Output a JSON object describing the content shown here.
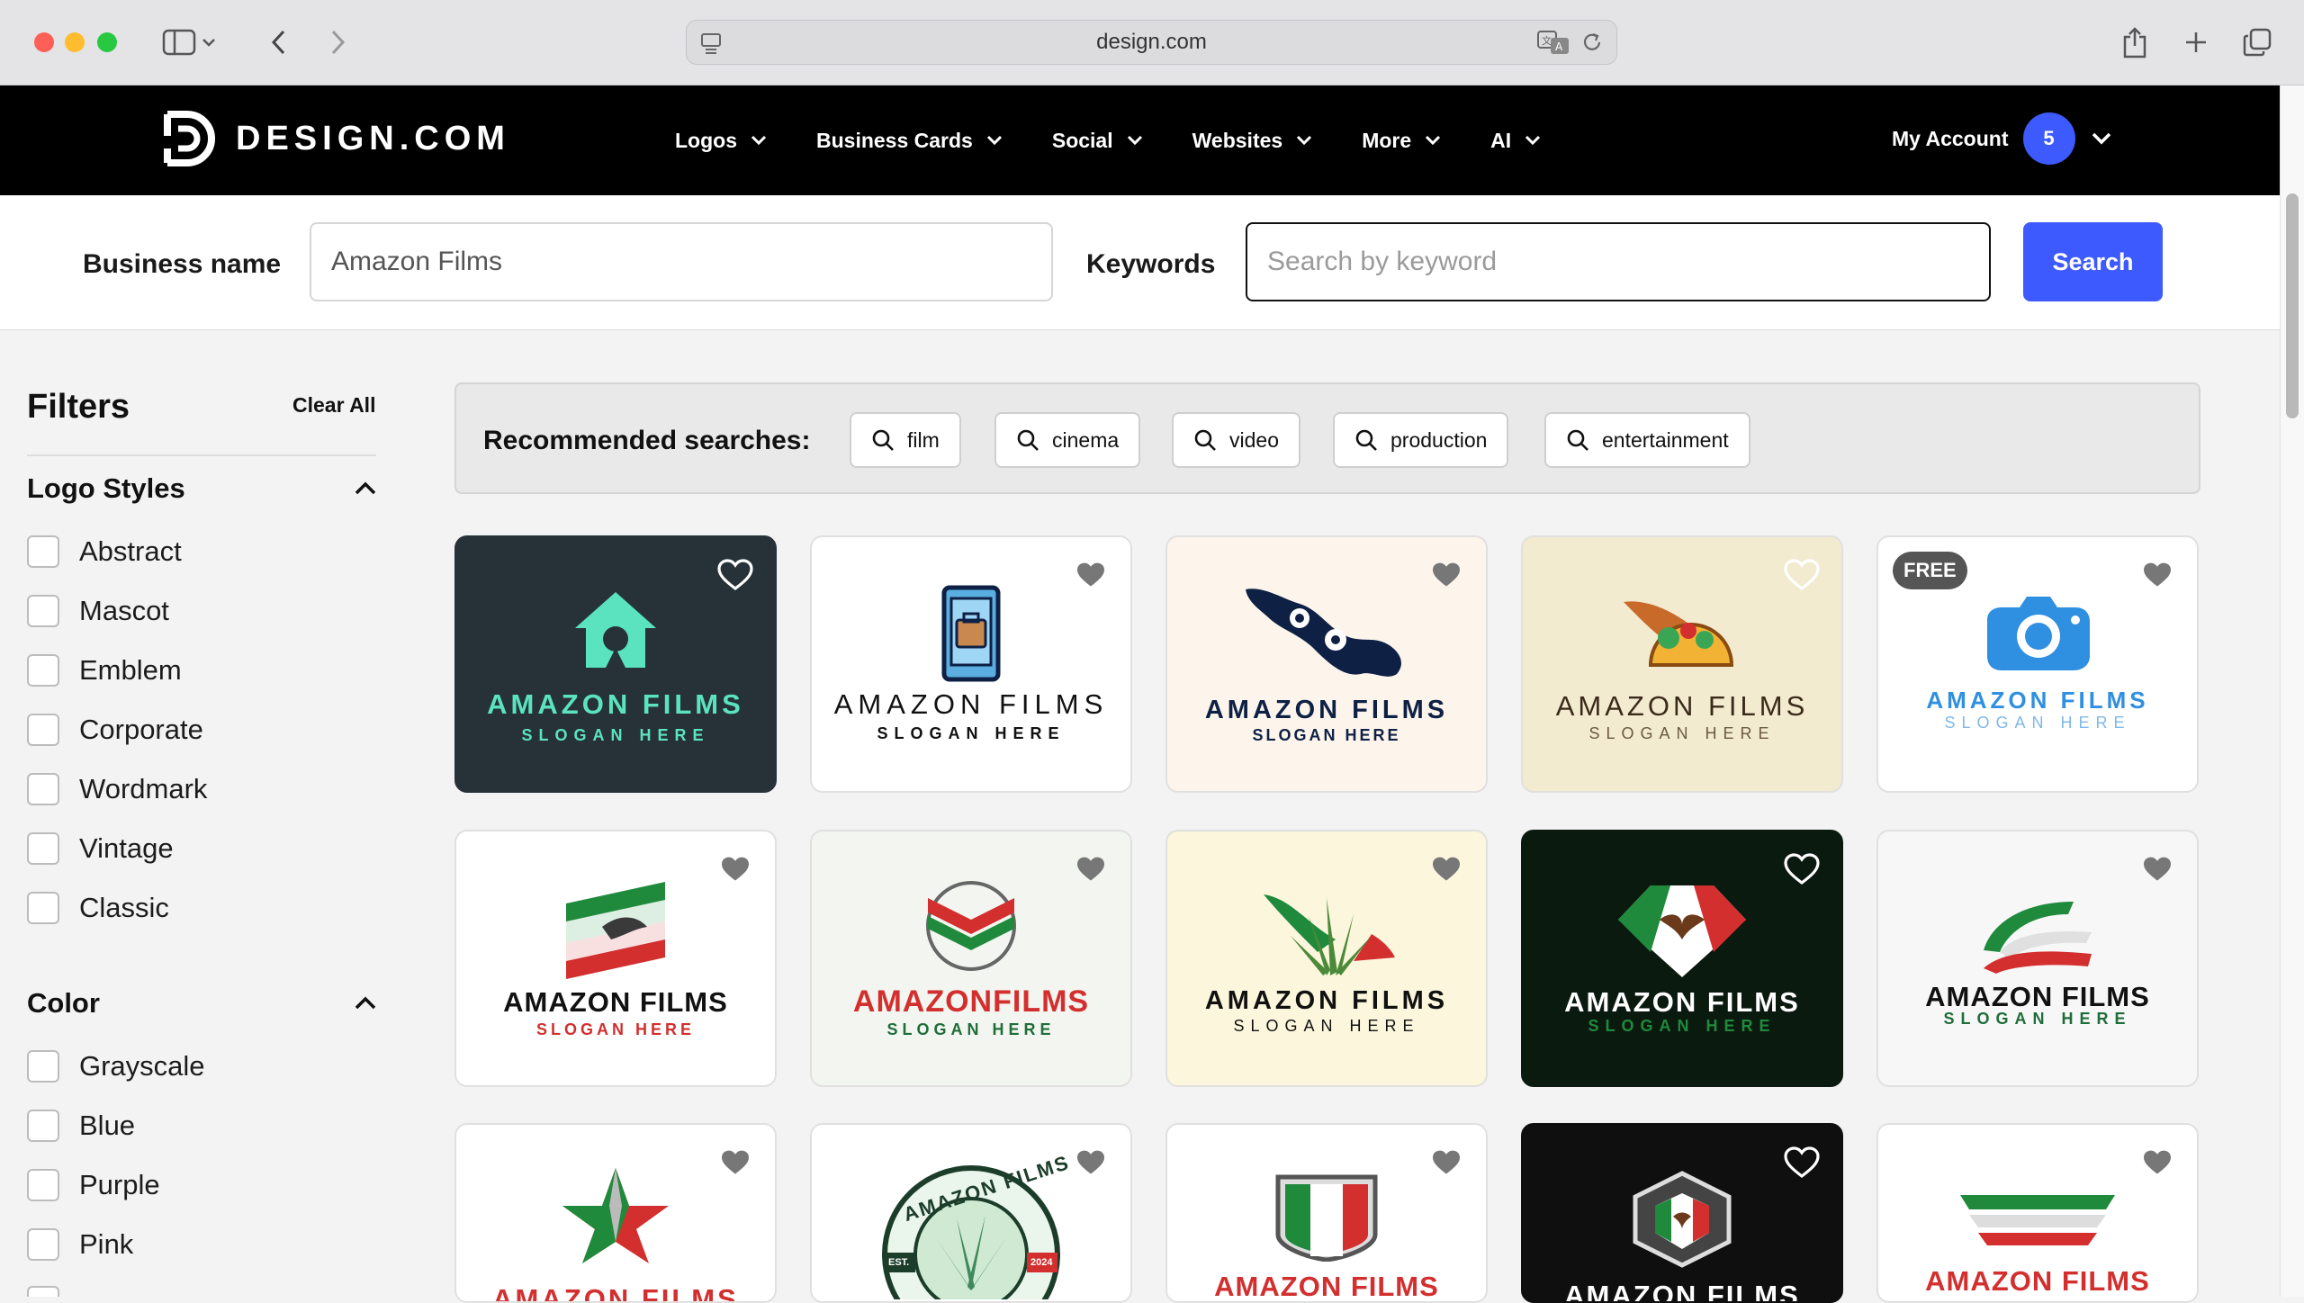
{
  "browser": {
    "url": "design.com"
  },
  "nav": {
    "brand": "DESIGN.COM",
    "items": [
      {
        "label": "Logos"
      },
      {
        "label": "Business Cards"
      },
      {
        "label": "Social"
      },
      {
        "label": "Websites"
      },
      {
        "label": "More"
      },
      {
        "label": "AI"
      }
    ],
    "account_label": "My Account",
    "account_badge": "5"
  },
  "search": {
    "business_label": "Business name",
    "business_value": "Amazon Films",
    "keywords_label": "Keywords",
    "keywords_placeholder": "Search by keyword",
    "button_label": "Search"
  },
  "filters": {
    "title": "Filters",
    "clear_all": "Clear All",
    "logo_styles": {
      "title": "Logo Styles",
      "options": [
        "Abstract",
        "Mascot",
        "Emblem",
        "Corporate",
        "Wordmark",
        "Vintage",
        "Classic"
      ]
    },
    "color": {
      "title": "Color",
      "options": [
        "Grayscale",
        "Blue",
        "Purple",
        "Pink"
      ]
    }
  },
  "recommended": {
    "label": "Recommended searches:",
    "chips": [
      "film",
      "cinema",
      "video",
      "production",
      "entertainment"
    ]
  },
  "logos": {
    "name": "AMAZON FILMS",
    "name_joined": "AMAZONFILMS",
    "slogan": "SLOGAN HERE",
    "free_badge": "FREE",
    "est": "EST.",
    "year": "2024",
    "badge_ring": "AMAZON FILMS"
  },
  "colors": {
    "accent": "#3d5afe",
    "mint": "#5be3c0",
    "green": "#1f8a3c",
    "red": "#d32f2f",
    "navy": "#0e2145",
    "blue": "#2f8fe0"
  }
}
